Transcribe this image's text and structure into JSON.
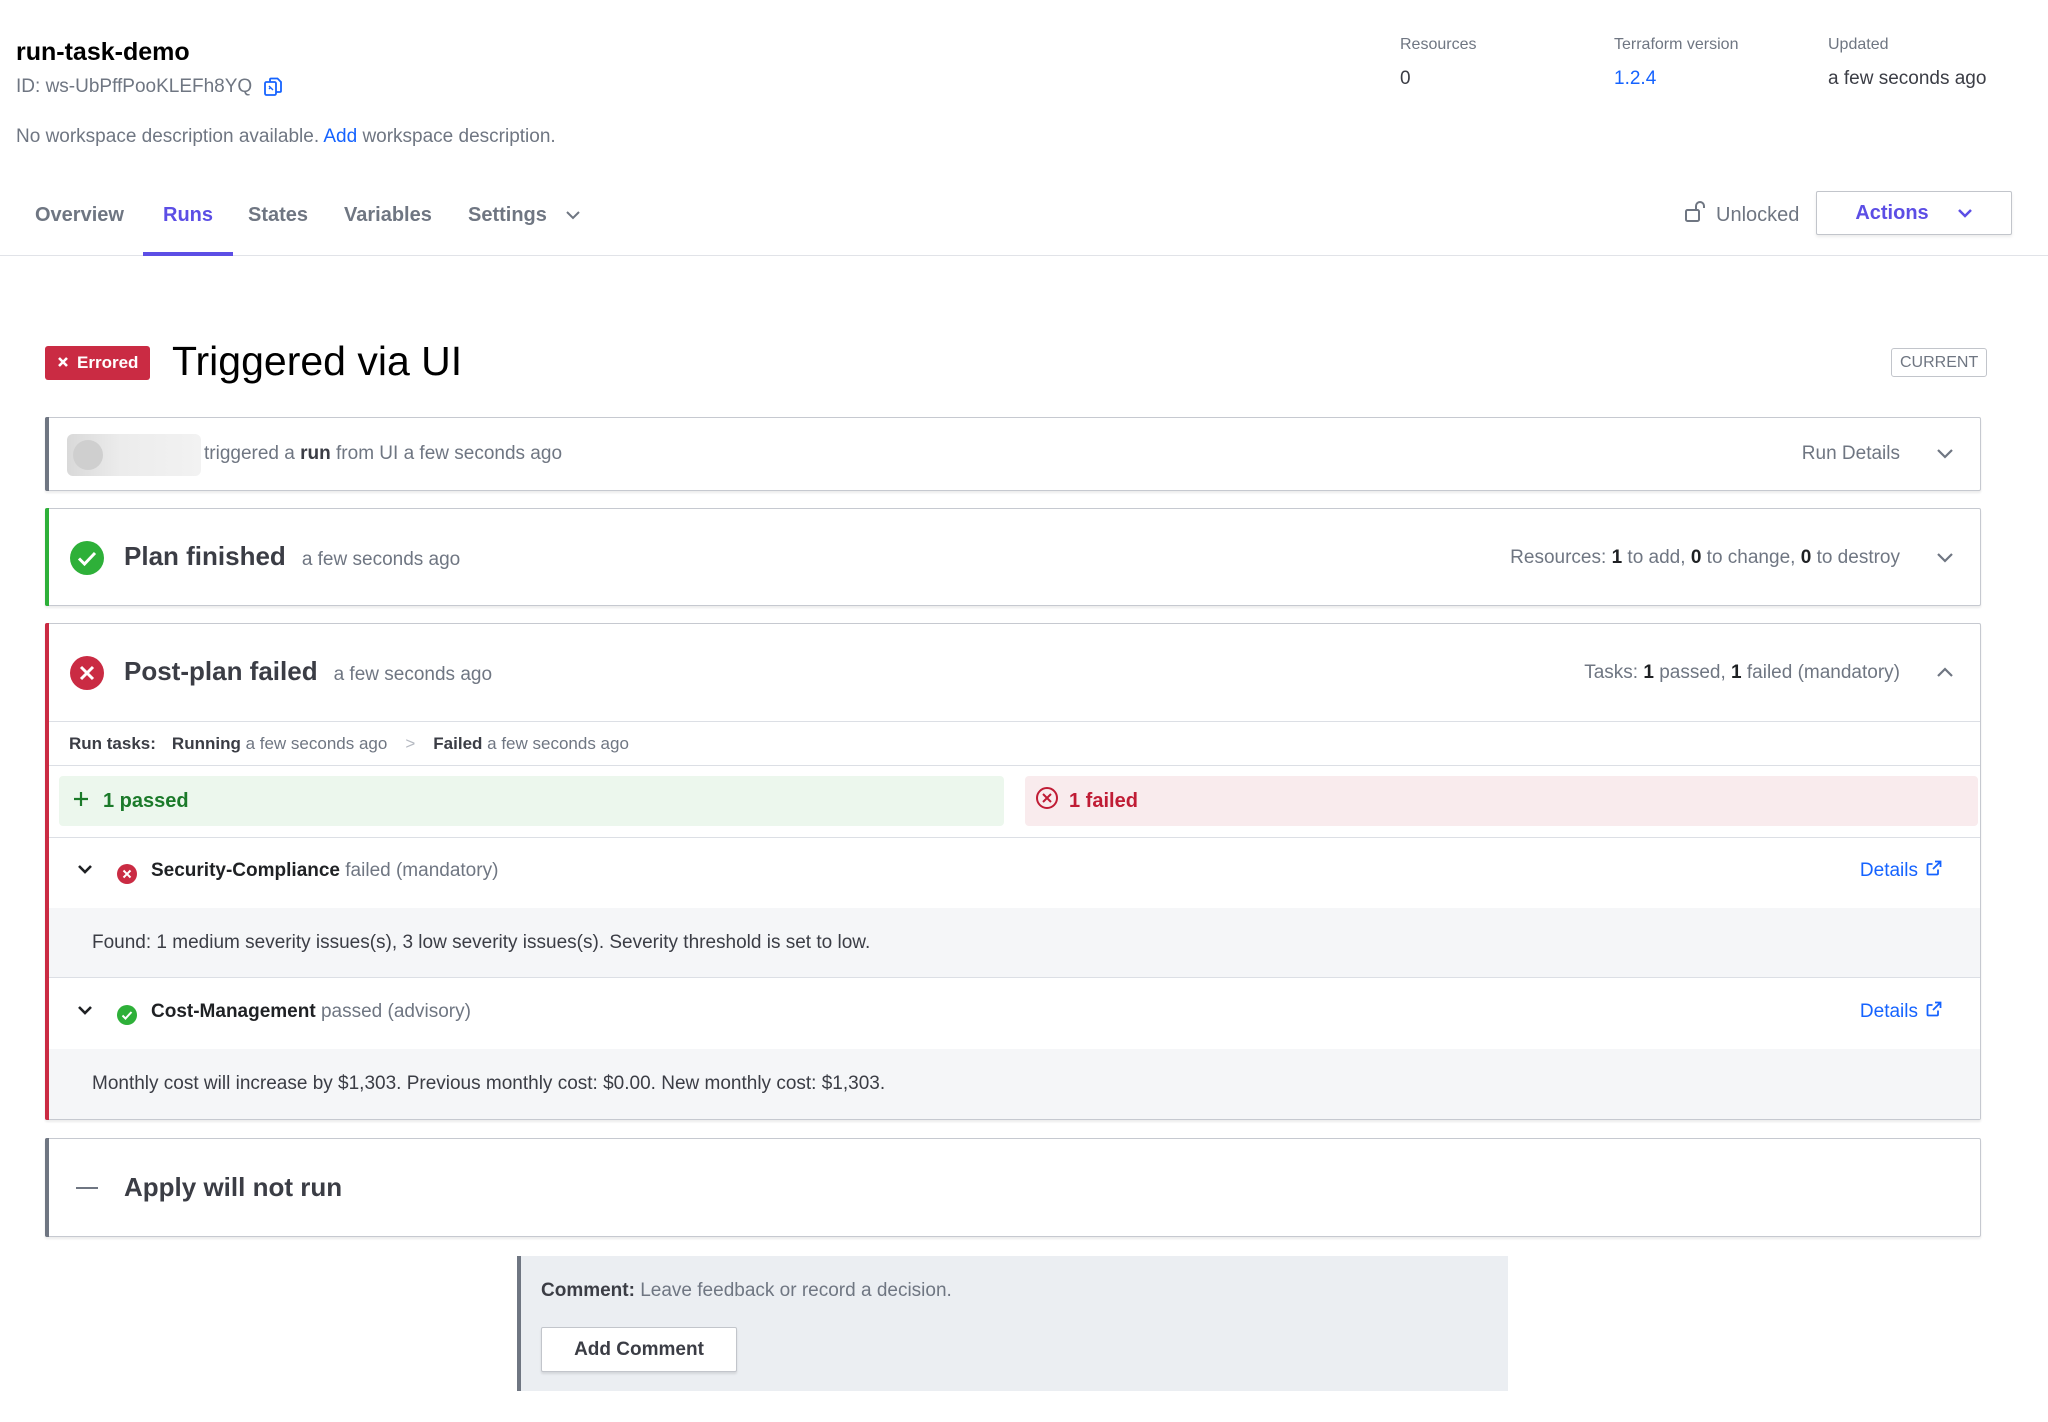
{
  "workspace": {
    "name": "run-task-demo",
    "id_label": "ID:",
    "id_value": "ws-UbPffPooKLEFh8YQ",
    "description_prefix": "No workspace description available.",
    "description_link": "Add",
    "description_suffix": "workspace description."
  },
  "meta": {
    "resources": {
      "label": "Resources",
      "value": "0"
    },
    "terraform_version": {
      "label": "Terraform version",
      "value": "1.2.4"
    },
    "updated": {
      "label": "Updated",
      "value": "a few seconds ago"
    }
  },
  "tabs": [
    {
      "label": "Overview",
      "active": false
    },
    {
      "label": "Runs",
      "active": true
    },
    {
      "label": "States",
      "active": false
    },
    {
      "label": "Variables",
      "active": false
    },
    {
      "label": "Settings",
      "active": false,
      "has_dropdown": true
    }
  ],
  "lock_status": "Unlocked",
  "actions_label": "Actions",
  "run": {
    "status_badge": "Errored",
    "title": "Triggered via UI",
    "current_badge": "CURRENT",
    "trigger": {
      "prefix": "triggered a",
      "bold": "run",
      "suffix": "from UI a few seconds ago",
      "details_label": "Run Details"
    },
    "plan": {
      "title": "Plan finished",
      "time": "a few seconds ago",
      "resources_prefix": "Resources:",
      "add_count": "1",
      "add_label": "to add,",
      "change_count": "0",
      "change_label": "to change,",
      "destroy_count": "0",
      "destroy_label": "to destroy"
    },
    "post_plan": {
      "title": "Post-plan failed",
      "time": "a few seconds ago",
      "tasks_prefix": "Tasks:",
      "passed_count": "1",
      "passed_label": "passed,",
      "failed_count": "1",
      "failed_label": "failed (mandatory)",
      "run_tasks_label": "Run tasks:",
      "running_label": "Running",
      "running_time": "a few seconds ago",
      "separator": ">",
      "failed_state_label": "Failed",
      "failed_time": "a few seconds ago",
      "passed_summary": "1 passed",
      "failed_summary": "1 failed",
      "tasks": [
        {
          "name": "Security-Compliance",
          "status": "failed (mandatory)",
          "details_label": "Details",
          "message": "Found: 1 medium severity issues(s), 3 low severity issues(s). Severity threshold is set to low."
        },
        {
          "name": "Cost-Management",
          "status": "passed (advisory)",
          "details_label": "Details",
          "message": "Monthly cost will increase by $1,303. Previous monthly cost: $0.00. New monthly cost: $1,303."
        }
      ]
    },
    "apply": {
      "title": "Apply will not run"
    }
  },
  "comment": {
    "label": "Comment:",
    "prompt": "Leave feedback or record a decision.",
    "button_label": "Add Comment"
  },
  "colors": {
    "accent": "#5c4ee5",
    "link": "#1563ff",
    "error": "#ca2b43",
    "success": "#2eb039"
  }
}
